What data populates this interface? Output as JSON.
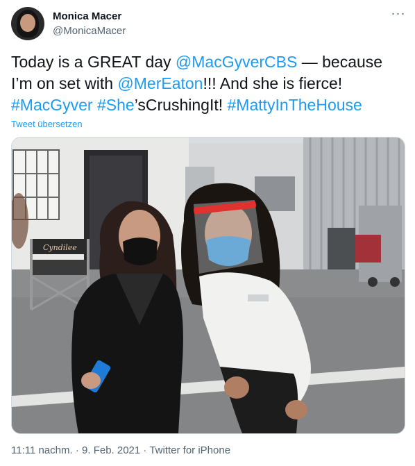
{
  "author": {
    "name": "Monica Macer",
    "handle": "@MonicaMacer"
  },
  "menu": {
    "more_label": "···"
  },
  "tweet": {
    "segments": [
      {
        "text": "Today is a GREAT day ",
        "link": false
      },
      {
        "text": "@MacGyverCBS",
        "link": true
      },
      {
        "text": " — because I’m on set with ",
        "link": false
      },
      {
        "text": "@MerEaton",
        "link": true
      },
      {
        "text": "!!! And she is fierce! ",
        "link": false
      },
      {
        "text": "#MacGyver",
        "link": true
      },
      {
        "text": " ",
        "link": false
      },
      {
        "text": "#She",
        "link": true
      },
      {
        "text": "’sCrushingIt! ",
        "link": false
      },
      {
        "text": "#MattyInTheHouse",
        "link": true
      }
    ],
    "translate_label": "Tweet übersetzen"
  },
  "photo": {
    "chair_text": "Cyndilee"
  },
  "meta": {
    "time": "11:11 nachm.",
    "separator1": " · ",
    "date": "9. Feb. 2021",
    "separator2": " · ",
    "source": "Twitter for iPhone"
  },
  "colors": {
    "link": "#1d9bf0",
    "secondary_text": "#536471",
    "primary_text": "#0f1419"
  }
}
